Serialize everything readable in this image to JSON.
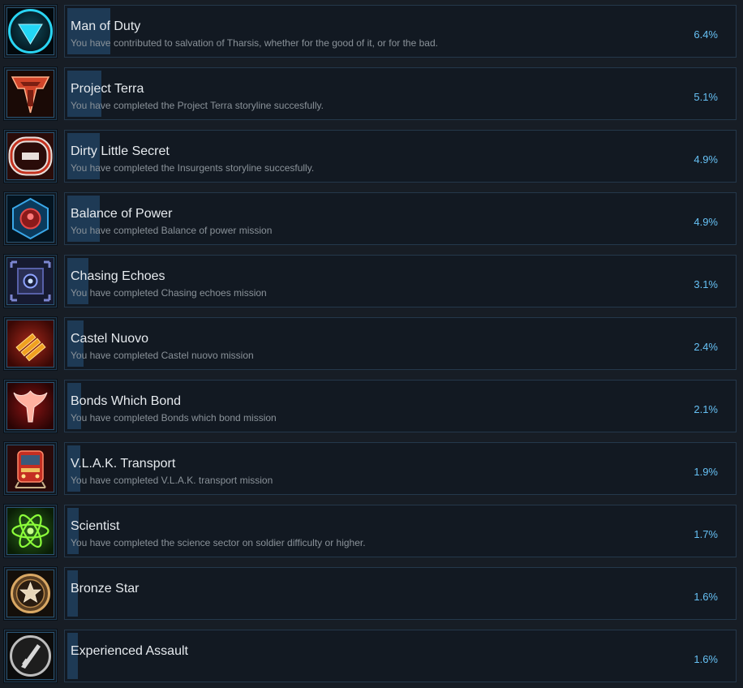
{
  "achievements": [
    {
      "title": "Man of Duty",
      "description": "You have contributed to salvation of Tharsis, whether for the good of it, or for the bad.",
      "percent": "6.4%",
      "icon": "downward-triangle-emblem-icon"
    },
    {
      "title": "Project Terra",
      "description": "You have completed the Project Terra storyline succesfully.",
      "percent": "5.1%",
      "icon": "terra-shield-emblem-icon"
    },
    {
      "title": "Dirty Little Secret",
      "description": "You have completed the Insurgents storyline succesfully.",
      "percent": "4.9%",
      "icon": "insurgent-ring-emblem-icon"
    },
    {
      "title": "Balance of Power",
      "description": "You have completed Balance of power mission",
      "percent": "4.9%",
      "icon": "balance-hex-emblem-icon"
    },
    {
      "title": "Chasing Echoes",
      "description": "You have completed Chasing echoes mission",
      "percent": "3.1%",
      "icon": "echo-target-icon"
    },
    {
      "title": "Castel Nuovo",
      "description": "You have completed Castel nuovo mission",
      "percent": "2.4%",
      "icon": "bullets-icon"
    },
    {
      "title": "Bonds Which Bond",
      "description": "You have completed Bonds which bond mission",
      "percent": "2.1%",
      "icon": "red-creature-emblem-icon"
    },
    {
      "title": "V.L.A.K. Transport",
      "description": "You have completed V.L.A.K. transport mission",
      "percent": "1.9%",
      "icon": "train-icon"
    },
    {
      "title": "Scientist",
      "description": "You have completed the science sector on soldier difficulty or higher.",
      "percent": "1.7%",
      "icon": "atom-icon"
    },
    {
      "title": "Bronze Star",
      "description": "",
      "percent": "1.6%",
      "icon": "bronze-star-medal-icon"
    },
    {
      "title": "Experienced Assault",
      "description": "",
      "percent": "1.6%",
      "icon": "assault-rifle-icon"
    }
  ],
  "colors": {
    "background": "#171d25",
    "panel": "#121922",
    "progress_fill": "#1e3a55",
    "percent_text": "#66c0f4"
  }
}
